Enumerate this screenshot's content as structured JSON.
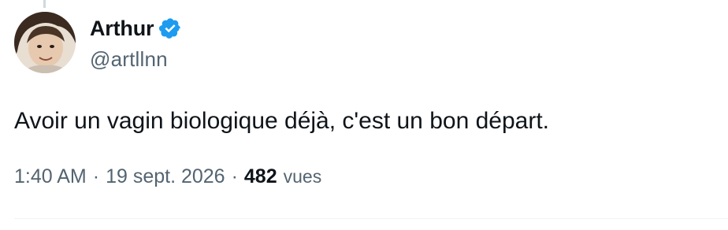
{
  "author": {
    "display_name": "Arthur",
    "handle": "@artllnn",
    "verified": true
  },
  "tweet": {
    "text": "Avoir un vagin biologique déjà, c'est un bon départ.",
    "time": "1:40 AM",
    "separator": "·",
    "date": "19 sept. 2026",
    "views_count": "482",
    "views_label": "vues"
  },
  "colors": {
    "text_primary": "#0f1419",
    "text_secondary": "#536471",
    "verified_badge": "#1d9bf0",
    "divider": "#eff3f4"
  },
  "icons": {
    "verified": "verified-badge-icon"
  }
}
